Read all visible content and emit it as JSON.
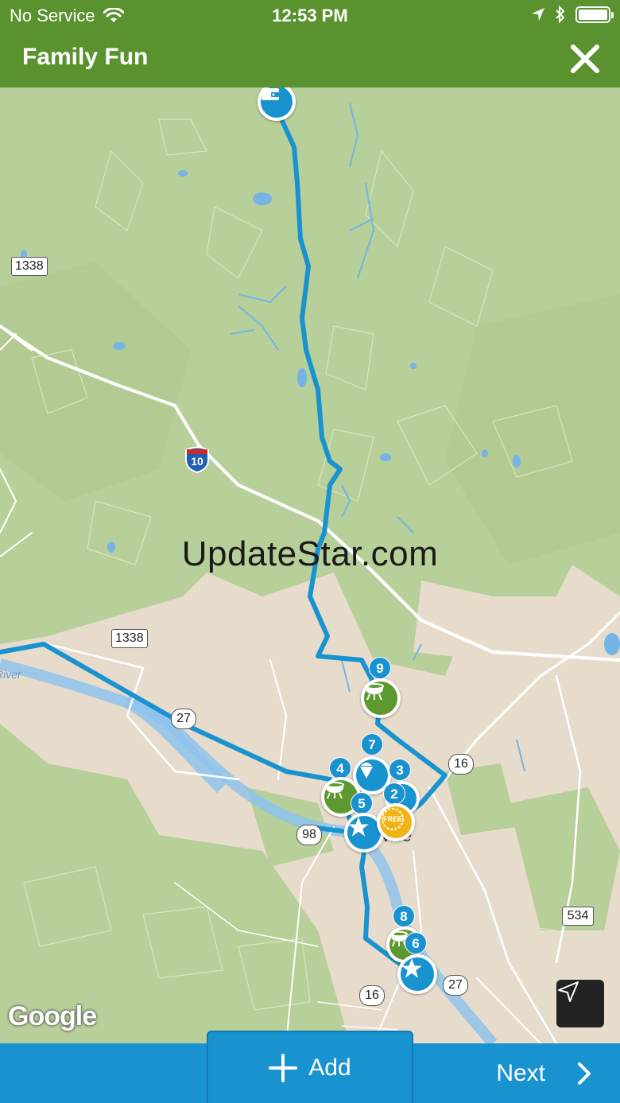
{
  "status_bar": {
    "carrier": "No Service",
    "time": "12:53 PM"
  },
  "nav": {
    "title": "Family Fun",
    "close_icon": "close-x-icon"
  },
  "map": {
    "watermark": "UpdateStar.com",
    "attribution": "Google",
    "route_badges": [
      "1338",
      "1338",
      "27",
      "98",
      "16",
      "16",
      "27",
      "534"
    ],
    "interstate": "10",
    "water_label": "River",
    "town_label": "ville",
    "stop_numbers": [
      "9",
      "7",
      "4",
      "3",
      "2",
      "5",
      "8",
      "6"
    ],
    "colors": {
      "route": "#1992d0",
      "land": "#b7cf98",
      "urban": "#e7dccb",
      "accent_green": "#5a922f"
    }
  },
  "bottom": {
    "add_label": "Add",
    "next_label": "Next"
  }
}
